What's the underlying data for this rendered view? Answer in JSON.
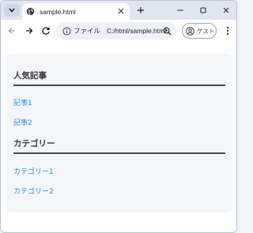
{
  "browser": {
    "tab_title": "sample.html",
    "omnibox_label": "ファイル",
    "url": "C:/html/sample.html",
    "profile_label": "ゲスト",
    "accent": "#1f1f1f"
  },
  "page": {
    "sections": [
      {
        "title": "人気記事",
        "links": [
          "記事1",
          "記事2"
        ]
      },
      {
        "title": "カテゴリー",
        "links": [
          "カテゴリー1",
          "カテゴリー2"
        ]
      }
    ],
    "link_color": "#2b8ce0",
    "card_color": "#f4f6f9"
  }
}
